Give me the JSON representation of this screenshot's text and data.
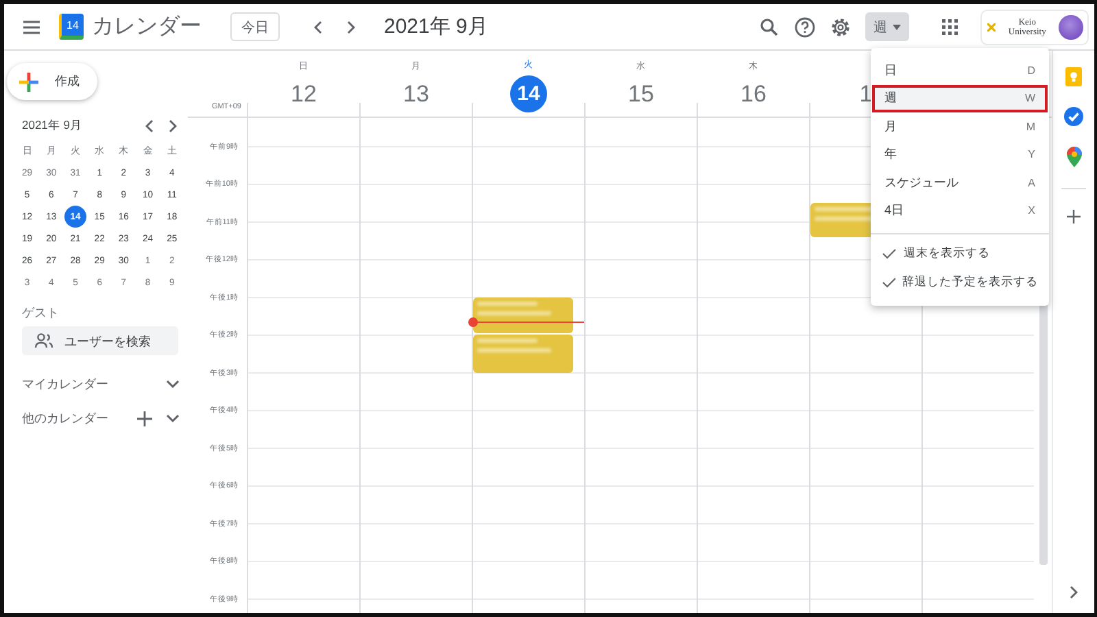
{
  "header": {
    "logo_day": "14",
    "app_title": "カレンダー",
    "today_button": "今日",
    "period": "2021年 9月",
    "view_button": "週",
    "account": "Keio University"
  },
  "sidebar": {
    "create_button": "作成",
    "mini_calendar": {
      "title": "2021年 9月",
      "weekdays": [
        "日",
        "月",
        "火",
        "水",
        "木",
        "金",
        "土"
      ],
      "days": [
        {
          "label": "29",
          "other_month": true,
          "selected": false
        },
        {
          "label": "30",
          "other_month": true,
          "selected": false
        },
        {
          "label": "31",
          "other_month": true,
          "selected": false
        },
        {
          "label": "1",
          "other_month": false,
          "selected": false
        },
        {
          "label": "2",
          "other_month": false,
          "selected": false
        },
        {
          "label": "3",
          "other_month": false,
          "selected": false
        },
        {
          "label": "4",
          "other_month": false,
          "selected": false
        },
        {
          "label": "5",
          "other_month": false,
          "selected": false
        },
        {
          "label": "6",
          "other_month": false,
          "selected": false
        },
        {
          "label": "7",
          "other_month": false,
          "selected": false
        },
        {
          "label": "8",
          "other_month": false,
          "selected": false
        },
        {
          "label": "9",
          "other_month": false,
          "selected": false
        },
        {
          "label": "10",
          "other_month": false,
          "selected": false
        },
        {
          "label": "11",
          "other_month": false,
          "selected": false
        },
        {
          "label": "12",
          "other_month": false,
          "selected": false
        },
        {
          "label": "13",
          "other_month": false,
          "selected": false
        },
        {
          "label": "14",
          "other_month": false,
          "selected": true
        },
        {
          "label": "15",
          "other_month": false,
          "selected": false
        },
        {
          "label": "16",
          "other_month": false,
          "selected": false
        },
        {
          "label": "17",
          "other_month": false,
          "selected": false
        },
        {
          "label": "18",
          "other_month": false,
          "selected": false
        },
        {
          "label": "19",
          "other_month": false,
          "selected": false
        },
        {
          "label": "20",
          "other_month": false,
          "selected": false
        },
        {
          "label": "21",
          "other_month": false,
          "selected": false
        },
        {
          "label": "22",
          "other_month": false,
          "selected": false
        },
        {
          "label": "23",
          "other_month": false,
          "selected": false
        },
        {
          "label": "24",
          "other_month": false,
          "selected": false
        },
        {
          "label": "25",
          "other_month": false,
          "selected": false
        },
        {
          "label": "26",
          "other_month": false,
          "selected": false
        },
        {
          "label": "27",
          "other_month": false,
          "selected": false
        },
        {
          "label": "28",
          "other_month": false,
          "selected": false
        },
        {
          "label": "29",
          "other_month": false,
          "selected": false
        },
        {
          "label": "30",
          "other_month": false,
          "selected": false
        },
        {
          "label": "1",
          "other_month": true,
          "selected": false
        },
        {
          "label": "2",
          "other_month": true,
          "selected": false
        },
        {
          "label": "3",
          "other_month": true,
          "selected": false
        },
        {
          "label": "4",
          "other_month": true,
          "selected": false
        },
        {
          "label": "5",
          "other_month": true,
          "selected": false
        },
        {
          "label": "6",
          "other_month": true,
          "selected": false
        },
        {
          "label": "7",
          "other_month": true,
          "selected": false
        },
        {
          "label": "8",
          "other_month": true,
          "selected": false
        },
        {
          "label": "9",
          "other_month": true,
          "selected": false
        }
      ]
    },
    "guest_label": "ゲスト",
    "user_search": {
      "placeholder": "ユーザーを検索"
    },
    "sections": [
      {
        "label": "マイカレンダー",
        "can_add": false
      },
      {
        "label": "他のカレンダー",
        "can_add": true
      }
    ]
  },
  "week": {
    "timezone": "GMT+09",
    "days": [
      {
        "weekday": "日",
        "date": "12",
        "today": false
      },
      {
        "weekday": "月",
        "date": "13",
        "today": false
      },
      {
        "weekday": "火",
        "date": "14",
        "today": true,
        "events": [
          {
            "kind": "event"
          },
          {
            "kind": "event"
          }
        ]
      },
      {
        "weekday": "水",
        "date": "15",
        "today": false
      },
      {
        "weekday": "木",
        "date": "16",
        "today": false
      },
      {
        "date": "1",
        "today": false,
        "events": [
          {
            "kind": "event"
          }
        ]
      }
    ],
    "hours": [
      "午前9時",
      "午前10時",
      "午前11時",
      "午後12時",
      "午後1時",
      "午後2時",
      "午後3時",
      "午後4時",
      "午後5時",
      "午後6時",
      "午後7時",
      "午後8時",
      "午後9時"
    ]
  },
  "view_menu": {
    "items": [
      {
        "label": "日",
        "shortcut": "D",
        "selected": false
      },
      {
        "label": "週",
        "shortcut": "W",
        "selected": true
      },
      {
        "label": "月",
        "shortcut": "M",
        "selected": false
      },
      {
        "label": "年",
        "shortcut": "Y",
        "selected": false
      },
      {
        "label": "スケジュール",
        "shortcut": "A",
        "selected": false
      },
      {
        "label": "4日",
        "shortcut": "X",
        "selected": false
      }
    ],
    "options": [
      {
        "label": "週末を表示する",
        "checked": true
      },
      {
        "label": "辞退した予定を表示する",
        "checked": true
      }
    ]
  }
}
